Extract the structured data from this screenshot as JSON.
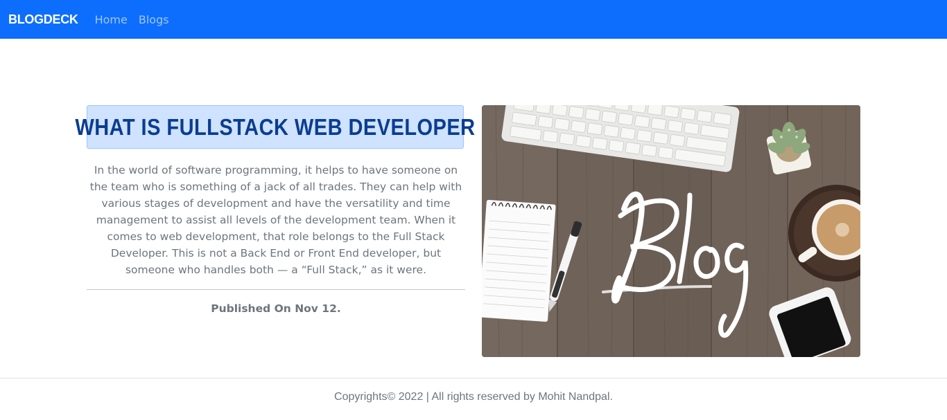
{
  "navbar": {
    "brand": "BLOGDECK",
    "links": [
      "Home",
      "Blogs"
    ],
    "color": "#0d6efd"
  },
  "post": {
    "title": "WHAT IS FULLSTACK WEB DEVELOPER",
    "description": "In the world of software programming, it helps to have someone on the team who is something of a jack of all trades. They can help with various stages of development and have the versatility and time management to assist all levels of the development team. When it comes to web development, that role belongs to the Full Stack Developer. This is not a Back End or Front End developer, but someone who handles both — a “Full Stack,” as it were.",
    "published": "Published On Nov 12.",
    "image_caption": "Blog"
  },
  "footer": {
    "text": "Copyrights© 2022 | All rights reserved by Mohit Nandpal."
  }
}
